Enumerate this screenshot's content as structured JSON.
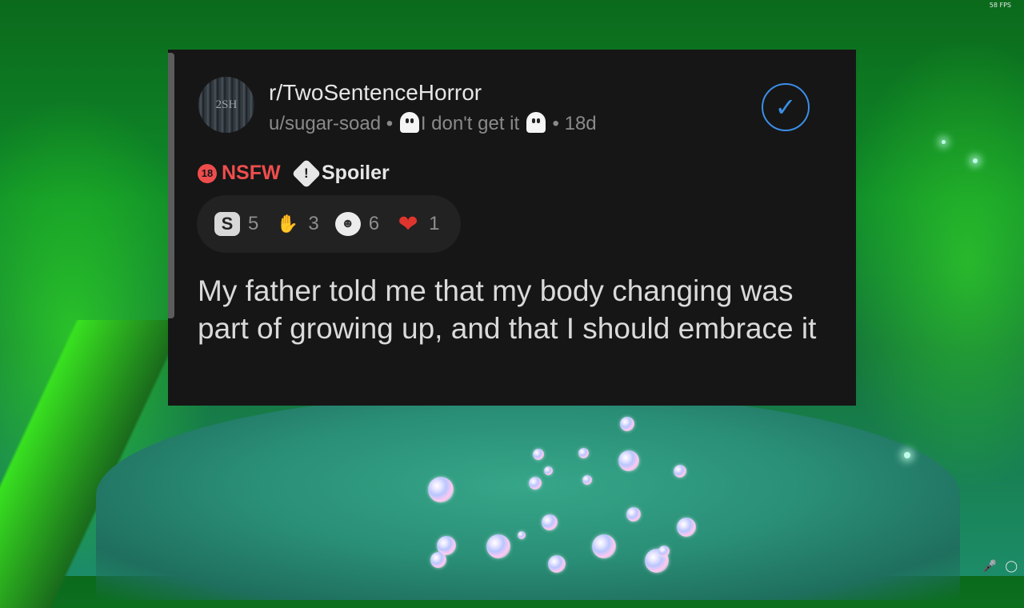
{
  "overlay": {
    "fps": "58 FPS"
  },
  "post": {
    "avatar_text": "2SH",
    "subreddit": "r/TwoSentenceHorror",
    "author": "u/sugar-soad",
    "flair": "I don't get it",
    "age": "18d",
    "verified_icon": "check-circle-icon",
    "tags": {
      "nsfw": "NSFW",
      "nsfw_badge": "18",
      "spoiler": "Spoiler"
    },
    "awards": [
      {
        "icon": "silver-award-icon",
        "count": "5"
      },
      {
        "icon": "helpful-hands-icon",
        "count": "3"
      },
      {
        "icon": "wholesome-face-icon",
        "count": "6"
      },
      {
        "icon": "heart-award-icon",
        "count": "1"
      }
    ],
    "title": "My father told me that my body changing was part of growing up, and that I should embrace it"
  },
  "colors": {
    "card_bg": "#161616",
    "nsfw": "#ef4d4d",
    "verified": "#3b8ee6"
  }
}
